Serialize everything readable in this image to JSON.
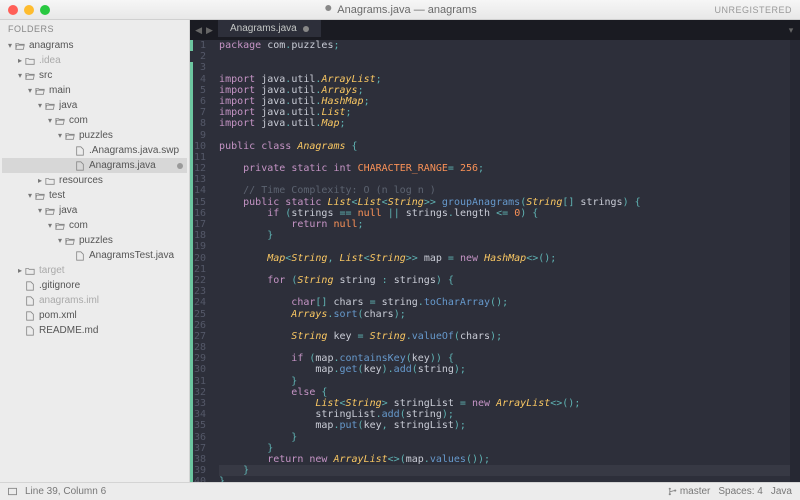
{
  "window": {
    "title": "Anagrams.java — anagrams",
    "unregistered": "UNREGISTERED"
  },
  "sidebar": {
    "header": "FOLDERS",
    "tree": [
      {
        "depth": 0,
        "kind": "folder-open",
        "name": "anagrams",
        "open": true
      },
      {
        "depth": 1,
        "kind": "folder",
        "name": ".idea",
        "dim": true,
        "open": false
      },
      {
        "depth": 1,
        "kind": "folder-open",
        "name": "src",
        "open": true
      },
      {
        "depth": 2,
        "kind": "folder-open",
        "name": "main",
        "open": true
      },
      {
        "depth": 3,
        "kind": "folder-open",
        "name": "java",
        "open": true
      },
      {
        "depth": 4,
        "kind": "folder-open",
        "name": "com",
        "open": true
      },
      {
        "depth": 5,
        "kind": "folder-open",
        "name": "puzzles",
        "open": true
      },
      {
        "depth": 6,
        "kind": "file",
        "name": ".Anagrams.java.swp"
      },
      {
        "depth": 6,
        "kind": "file",
        "name": "Anagrams.java",
        "selected": true,
        "dirty": true
      },
      {
        "depth": 3,
        "kind": "folder",
        "name": "resources",
        "open": false
      },
      {
        "depth": 2,
        "kind": "folder-open",
        "name": "test",
        "open": true
      },
      {
        "depth": 3,
        "kind": "folder-open",
        "name": "java",
        "open": true
      },
      {
        "depth": 4,
        "kind": "folder-open",
        "name": "com",
        "open": true
      },
      {
        "depth": 5,
        "kind": "folder-open",
        "name": "puzzles",
        "open": true
      },
      {
        "depth": 6,
        "kind": "file",
        "name": "AnagramsTest.java"
      },
      {
        "depth": 1,
        "kind": "folder",
        "name": "target",
        "dim": true,
        "open": false
      },
      {
        "depth": 1,
        "kind": "file",
        "name": ".gitignore"
      },
      {
        "depth": 1,
        "kind": "file",
        "name": "anagrams.iml",
        "dim": true
      },
      {
        "depth": 1,
        "kind": "file",
        "name": "pom.xml"
      },
      {
        "depth": 1,
        "kind": "file",
        "name": "README.md"
      }
    ]
  },
  "tabs": [
    {
      "label": "Anagrams.java",
      "dirty": true,
      "active": true
    }
  ],
  "code": {
    "first_line": 1,
    "cursor_line": 39,
    "modified_ranges": [
      [
        1,
        1
      ],
      [
        3,
        40
      ]
    ],
    "lines": [
      [
        [
          "kw",
          "package"
        ],
        [
          "",
          " com"
        ],
        [
          "op",
          "."
        ],
        [
          "",
          "puzzles"
        ],
        [
          "op",
          ";"
        ]
      ],
      [],
      [],
      [
        [
          "kw",
          "import"
        ],
        [
          "",
          " java"
        ],
        [
          "op",
          "."
        ],
        [
          "",
          "util"
        ],
        [
          "op",
          "."
        ],
        [
          "cls",
          "ArrayList"
        ],
        [
          "op",
          ";"
        ]
      ],
      [
        [
          "kw",
          "import"
        ],
        [
          "",
          " java"
        ],
        [
          "op",
          "."
        ],
        [
          "",
          "util"
        ],
        [
          "op",
          "."
        ],
        [
          "cls",
          "Arrays"
        ],
        [
          "op",
          ";"
        ]
      ],
      [
        [
          "kw",
          "import"
        ],
        [
          "",
          " java"
        ],
        [
          "op",
          "."
        ],
        [
          "",
          "util"
        ],
        [
          "op",
          "."
        ],
        [
          "cls",
          "HashMap"
        ],
        [
          "op",
          ";"
        ]
      ],
      [
        [
          "kw",
          "import"
        ],
        [
          "",
          " java"
        ],
        [
          "op",
          "."
        ],
        [
          "",
          "util"
        ],
        [
          "op",
          "."
        ],
        [
          "cls",
          "List"
        ],
        [
          "op",
          ";"
        ]
      ],
      [
        [
          "kw",
          "import"
        ],
        [
          "",
          " java"
        ],
        [
          "op",
          "."
        ],
        [
          "",
          "util"
        ],
        [
          "op",
          "."
        ],
        [
          "cls",
          "Map"
        ],
        [
          "op",
          ";"
        ]
      ],
      [],
      [
        [
          "kw",
          "public"
        ],
        [
          "",
          " "
        ],
        [
          "kw",
          "class"
        ],
        [
          "",
          " "
        ],
        [
          "cls",
          "Anagrams"
        ],
        [
          "",
          " "
        ],
        [
          "op",
          "{"
        ]
      ],
      [],
      [
        [
          "",
          "    "
        ],
        [
          "kw",
          "private"
        ],
        [
          "",
          " "
        ],
        [
          "kw",
          "static"
        ],
        [
          "",
          " "
        ],
        [
          "type",
          "int"
        ],
        [
          "",
          " "
        ],
        [
          "const",
          "CHARACTER_RANGE"
        ],
        [
          "op",
          "="
        ],
        [
          "",
          " "
        ],
        [
          "num",
          "256"
        ],
        [
          "op",
          ";"
        ]
      ],
      [],
      [
        [
          "",
          "    "
        ],
        [
          "cmt",
          "// Time Complexity: O (n log n )"
        ]
      ],
      [
        [
          "",
          "    "
        ],
        [
          "kw",
          "public"
        ],
        [
          "",
          " "
        ],
        [
          "kw",
          "static"
        ],
        [
          "",
          " "
        ],
        [
          "cls",
          "List"
        ],
        [
          "op",
          "<"
        ],
        [
          "cls",
          "List"
        ],
        [
          "op",
          "<"
        ],
        [
          "cls",
          "String"
        ],
        [
          "op",
          ">>"
        ],
        [
          "",
          " "
        ],
        [
          "fn",
          "groupAnagrams"
        ],
        [
          "op",
          "("
        ],
        [
          "cls",
          "String"
        ],
        [
          "op",
          "[]"
        ],
        [
          "",
          " "
        ],
        [
          "",
          "strings"
        ],
        [
          "op",
          ")"
        ],
        [
          "",
          " "
        ],
        [
          "op",
          "{"
        ]
      ],
      [
        [
          "",
          "        "
        ],
        [
          "kw",
          "if"
        ],
        [
          "",
          " "
        ],
        [
          "op",
          "("
        ],
        [
          "",
          "strings "
        ],
        [
          "op",
          "=="
        ],
        [
          "",
          " "
        ],
        [
          "const",
          "null"
        ],
        [
          "",
          " "
        ],
        [
          "op",
          "||"
        ],
        [
          "",
          " strings"
        ],
        [
          "op",
          "."
        ],
        [
          "",
          "length "
        ],
        [
          "op",
          "<="
        ],
        [
          "",
          " "
        ],
        [
          "num",
          "0"
        ],
        [
          "op",
          ")"
        ],
        [
          "",
          " "
        ],
        [
          "op",
          "{"
        ]
      ],
      [
        [
          "",
          "            "
        ],
        [
          "kw",
          "return"
        ],
        [
          "",
          " "
        ],
        [
          "const",
          "null"
        ],
        [
          "op",
          ";"
        ]
      ],
      [
        [
          "",
          "        "
        ],
        [
          "op",
          "}"
        ]
      ],
      [],
      [
        [
          "",
          "        "
        ],
        [
          "cls",
          "Map"
        ],
        [
          "op",
          "<"
        ],
        [
          "cls",
          "String"
        ],
        [
          "op",
          ","
        ],
        [
          "",
          " "
        ],
        [
          "cls",
          "List"
        ],
        [
          "op",
          "<"
        ],
        [
          "cls",
          "String"
        ],
        [
          "op",
          ">>"
        ],
        [
          "",
          " map "
        ],
        [
          "op",
          "="
        ],
        [
          "",
          " "
        ],
        [
          "kw",
          "new"
        ],
        [
          "",
          " "
        ],
        [
          "cls",
          "HashMap"
        ],
        [
          "op",
          "<>();"
        ]
      ],
      [],
      [
        [
          "",
          "        "
        ],
        [
          "kw",
          "for"
        ],
        [
          "",
          " "
        ],
        [
          "op",
          "("
        ],
        [
          "cls",
          "String"
        ],
        [
          "",
          " string "
        ],
        [
          "op",
          ":"
        ],
        [
          "",
          " strings"
        ],
        [
          "op",
          ")"
        ],
        [
          "",
          " "
        ],
        [
          "op",
          "{"
        ]
      ],
      [],
      [
        [
          "",
          "            "
        ],
        [
          "type",
          "char"
        ],
        [
          "op",
          "[]"
        ],
        [
          "",
          " chars "
        ],
        [
          "op",
          "="
        ],
        [
          "",
          " string"
        ],
        [
          "op",
          "."
        ],
        [
          "fn",
          "toCharArray"
        ],
        [
          "op",
          "();"
        ]
      ],
      [
        [
          "",
          "            "
        ],
        [
          "cls",
          "Arrays"
        ],
        [
          "op",
          "."
        ],
        [
          "fn",
          "sort"
        ],
        [
          "op",
          "("
        ],
        [
          "",
          "chars"
        ],
        [
          "op",
          ");"
        ]
      ],
      [],
      [
        [
          "",
          "            "
        ],
        [
          "cls",
          "String"
        ],
        [
          "",
          " key "
        ],
        [
          "op",
          "="
        ],
        [
          "",
          " "
        ],
        [
          "cls",
          "String"
        ],
        [
          "op",
          "."
        ],
        [
          "fn",
          "valueOf"
        ],
        [
          "op",
          "("
        ],
        [
          "",
          "chars"
        ],
        [
          "op",
          ");"
        ]
      ],
      [],
      [
        [
          "",
          "            "
        ],
        [
          "kw",
          "if"
        ],
        [
          "",
          " "
        ],
        [
          "op",
          "("
        ],
        [
          "",
          "map"
        ],
        [
          "op",
          "."
        ],
        [
          "fn",
          "containsKey"
        ],
        [
          "op",
          "("
        ],
        [
          "",
          "key"
        ],
        [
          "op",
          "))"
        ],
        [
          "",
          " "
        ],
        [
          "op",
          "{"
        ]
      ],
      [
        [
          "",
          "                map"
        ],
        [
          "op",
          "."
        ],
        [
          "fn",
          "get"
        ],
        [
          "op",
          "("
        ],
        [
          "",
          "key"
        ],
        [
          "op",
          ")."
        ],
        [
          "fn",
          "add"
        ],
        [
          "op",
          "("
        ],
        [
          "",
          "string"
        ],
        [
          "op",
          ");"
        ]
      ],
      [
        [
          "",
          "            "
        ],
        [
          "op",
          "}"
        ]
      ],
      [
        [
          "",
          "            "
        ],
        [
          "kw",
          "else"
        ],
        [
          "",
          " "
        ],
        [
          "op",
          "{"
        ]
      ],
      [
        [
          "",
          "                "
        ],
        [
          "cls",
          "List"
        ],
        [
          "op",
          "<"
        ],
        [
          "cls",
          "String"
        ],
        [
          "op",
          ">"
        ],
        [
          "",
          " stringList "
        ],
        [
          "op",
          "="
        ],
        [
          "",
          " "
        ],
        [
          "kw",
          "new"
        ],
        [
          "",
          " "
        ],
        [
          "cls",
          "ArrayList"
        ],
        [
          "op",
          "<>();"
        ]
      ],
      [
        [
          "",
          "                stringList"
        ],
        [
          "op",
          "."
        ],
        [
          "fn",
          "add"
        ],
        [
          "op",
          "("
        ],
        [
          "",
          "string"
        ],
        [
          "op",
          ");"
        ]
      ],
      [
        [
          "",
          "                map"
        ],
        [
          "op",
          "."
        ],
        [
          "fn",
          "put"
        ],
        [
          "op",
          "("
        ],
        [
          "",
          "key"
        ],
        [
          "op",
          ","
        ],
        [
          "",
          " stringList"
        ],
        [
          "op",
          ");"
        ]
      ],
      [
        [
          "",
          "            "
        ],
        [
          "op",
          "}"
        ]
      ],
      [
        [
          "",
          "        "
        ],
        [
          "op",
          "}"
        ]
      ],
      [
        [
          "",
          "        "
        ],
        [
          "kw",
          "return"
        ],
        [
          "",
          " "
        ],
        [
          "kw",
          "new"
        ],
        [
          "",
          " "
        ],
        [
          "cls",
          "ArrayList"
        ],
        [
          "op",
          "<>("
        ],
        [
          "",
          "map"
        ],
        [
          "op",
          "."
        ],
        [
          "fn",
          "values"
        ],
        [
          "op",
          "());"
        ]
      ],
      [
        [
          "",
          "    "
        ],
        [
          "op",
          "}"
        ]
      ],
      [
        [
          "op",
          "}"
        ]
      ]
    ]
  },
  "status": {
    "cursor": "Line 39, Column 6",
    "branch": "master",
    "spaces": "Spaces: 4",
    "lang": "Java"
  }
}
